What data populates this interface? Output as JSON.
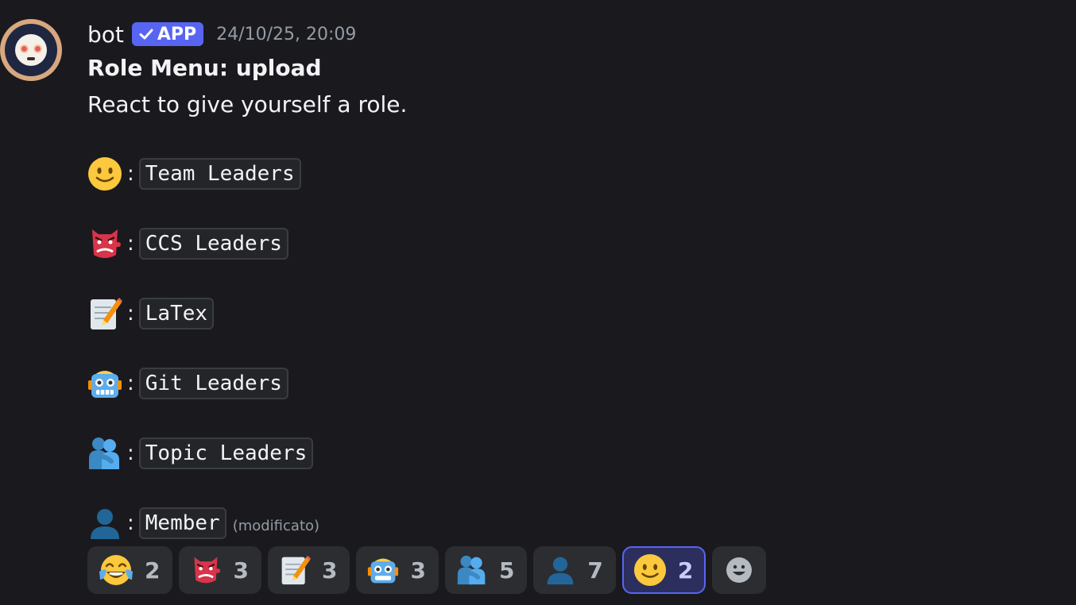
{
  "message": {
    "author": "bot",
    "badge": "APP",
    "timestamp": "24/10/25, 20:09",
    "title": "Role Menu: upload",
    "subtitle": "React to give yourself a role.",
    "colon": ":",
    "edited": "(modificato)"
  },
  "roles": [
    {
      "emoji": "slightly-smiling-face",
      "label": "Team Leaders"
    },
    {
      "emoji": "tengu-mask",
      "label": "CCS Leaders"
    },
    {
      "emoji": "memo",
      "label": "LaTex"
    },
    {
      "emoji": "robot",
      "label": "Git Leaders"
    },
    {
      "emoji": "people-hugging",
      "label": "Topic Leaders"
    },
    {
      "emoji": "bust-in-silhouette",
      "label": "Member"
    }
  ],
  "reactions": [
    {
      "emoji": "face-with-tears-of-joy",
      "count": "2",
      "active": false
    },
    {
      "emoji": "tengu-mask",
      "count": "3",
      "active": false
    },
    {
      "emoji": "memo",
      "count": "3",
      "active": false
    },
    {
      "emoji": "robot",
      "count": "3",
      "active": false
    },
    {
      "emoji": "people-hugging",
      "count": "5",
      "active": false
    },
    {
      "emoji": "bust-in-silhouette",
      "count": "7",
      "active": false
    },
    {
      "emoji": "slightly-smiling-face",
      "count": "2",
      "active": true
    }
  ],
  "colors": {
    "background": "#1a1a1e",
    "accent": "#5865f2",
    "muted_text": "#949ba4"
  }
}
